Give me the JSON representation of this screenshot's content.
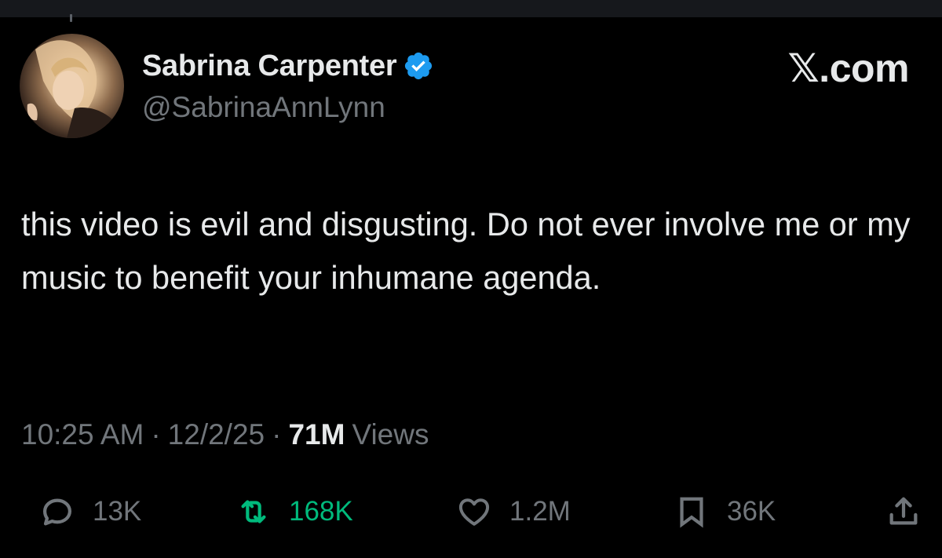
{
  "tweet": {
    "author": {
      "display_name": "Sabrina Carpenter",
      "handle": "@SabrinaAnnLynn",
      "verified_icon": "verified-badge-icon",
      "verified_color": "#1d9bf0"
    },
    "brand": "𝕏.com",
    "text": "this video is evil and disgusting. Do not ever involve me or my music to benefit your inhumane agenda.",
    "meta": {
      "time": "10:25 AM",
      "separator": "·",
      "date": "12/2/25",
      "views_count": "71M",
      "views_label": "Views"
    },
    "actions": {
      "reply": {
        "icon": "reply-icon",
        "count": "13K"
      },
      "repost": {
        "icon": "repost-icon",
        "count": "168K",
        "color": "#00ba7c"
      },
      "like": {
        "icon": "heart-icon",
        "count": "1.2M"
      },
      "bookmark": {
        "icon": "bookmark-icon",
        "count": "36K"
      },
      "share": {
        "icon": "share-icon"
      }
    }
  },
  "colors": {
    "background": "#000000",
    "text_primary": "#e7e9ea",
    "text_secondary": "#71767b",
    "accent_verified": "#1d9bf0",
    "repost_active": "#00ba7c"
  }
}
